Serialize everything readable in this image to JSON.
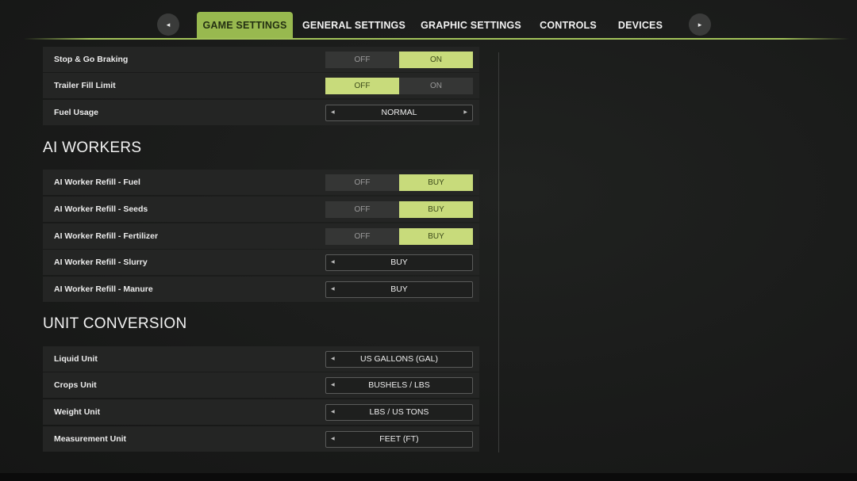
{
  "nav": {
    "prev_icon": "triangle-left-icon",
    "next_icon": "triangle-right-icon",
    "prev_glyph": "◂",
    "next_glyph": "▸",
    "tabs": [
      {
        "label": "GAME SETTINGS",
        "active": true
      },
      {
        "label": "GENERAL SETTINGS",
        "active": false
      },
      {
        "label": "GRAPHIC SETTINGS",
        "active": false
      },
      {
        "label": "CONTROLS",
        "active": false
      },
      {
        "label": "DEVICES",
        "active": false
      }
    ]
  },
  "settings_top": [
    {
      "label": "Stop & Go Braking",
      "type": "toggle",
      "options": [
        "OFF",
        "ON"
      ],
      "selected": 1
    },
    {
      "label": "Trailer Fill Limit",
      "type": "toggle",
      "options": [
        "OFF",
        "ON"
      ],
      "selected": 0
    },
    {
      "label": "Fuel Usage",
      "type": "select",
      "value": "NORMAL",
      "left_arrow": true,
      "right_arrow": true
    }
  ],
  "ai_workers": {
    "heading": "AI WORKERS",
    "items": [
      {
        "label": "AI Worker Refill - Fuel",
        "type": "toggle",
        "options": [
          "OFF",
          "BUY"
        ],
        "selected": 1
      },
      {
        "label": "AI Worker Refill - Seeds",
        "type": "toggle",
        "options": [
          "OFF",
          "BUY"
        ],
        "selected": 1
      },
      {
        "label": "AI Worker Refill - Fertilizer",
        "type": "toggle",
        "options": [
          "OFF",
          "BUY"
        ],
        "selected": 1
      },
      {
        "label": "AI Worker Refill - Slurry",
        "type": "select",
        "value": "BUY",
        "left_arrow": true,
        "right_arrow": false
      },
      {
        "label": "AI Worker Refill - Manure",
        "type": "select",
        "value": "BUY",
        "left_arrow": true,
        "right_arrow": false
      }
    ]
  },
  "unit_conversion": {
    "heading": "UNIT CONVERSION",
    "items": [
      {
        "label": "Liquid Unit",
        "type": "select",
        "value": "US GALLONS (GAL)",
        "left_arrow": true,
        "right_arrow": false
      },
      {
        "label": "Crops Unit",
        "type": "select",
        "value": "BUSHELS / LBS",
        "left_arrow": true,
        "right_arrow": false
      },
      {
        "label": "Weight Unit",
        "type": "select",
        "value": "LBS / US TONS",
        "left_arrow": true,
        "right_arrow": false
      },
      {
        "label": "Measurement Unit",
        "type": "select",
        "value": "FEET (FT)",
        "left_arrow": true,
        "right_arrow": false
      }
    ]
  },
  "colors": {
    "accent": "#98b94f",
    "toggle_on": "#c8db7b",
    "row_bg": "#242524"
  }
}
